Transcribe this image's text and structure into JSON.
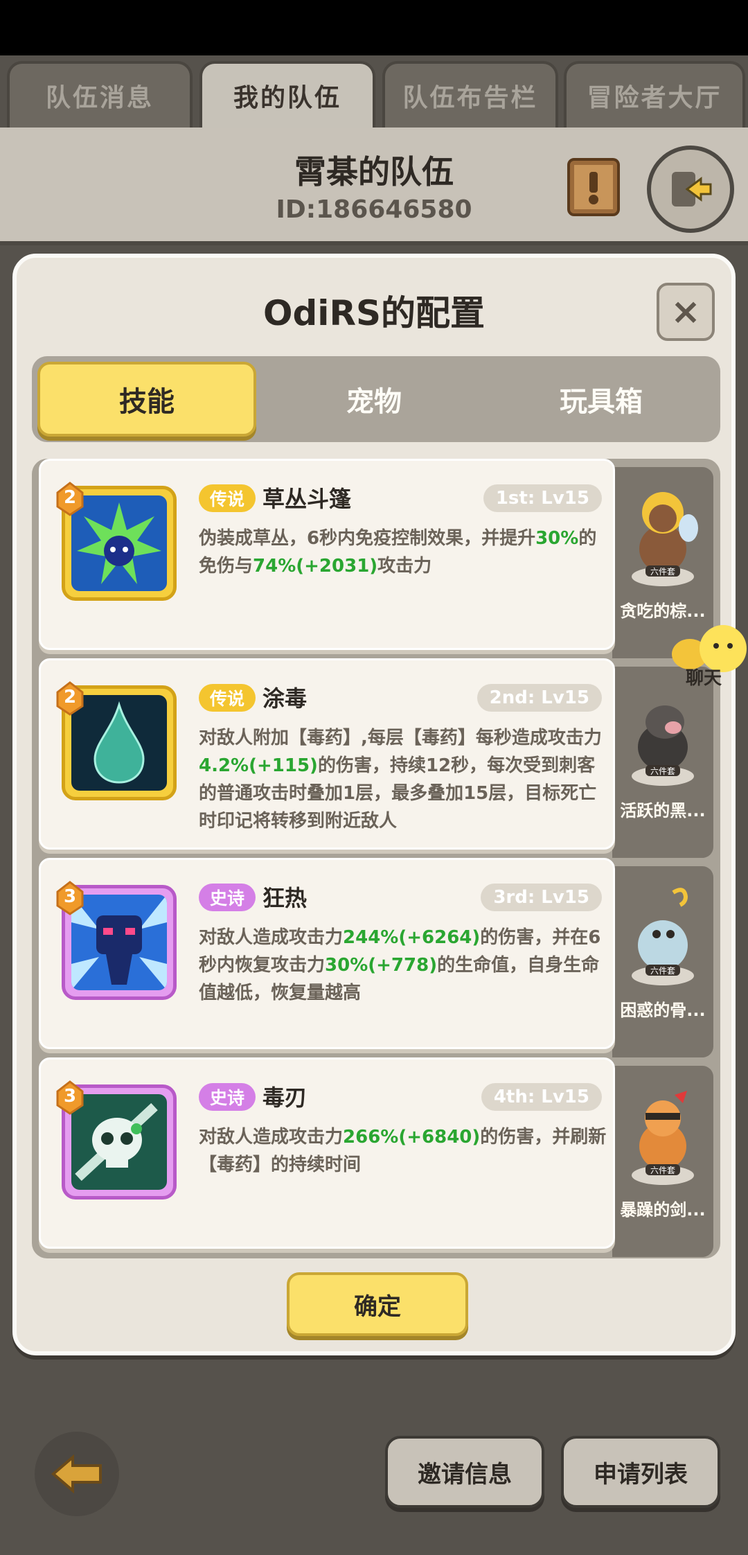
{
  "top_tabs": [
    "队伍消息",
    "我的队伍",
    "队伍布告栏",
    "冒险者大厅"
  ],
  "team": {
    "name": "霄棊的队伍",
    "id": "ID:186646580"
  },
  "modal": {
    "title": "OdiRS的配置",
    "close": "×",
    "tabs": [
      "技能",
      "宠物",
      "玩具箱"
    ],
    "confirm": "确定"
  },
  "skills": [
    {
      "level": "2",
      "rarity": "传说",
      "name": "草丛斗篷",
      "slot": "1st: Lv15",
      "desc": [
        "伪装成草丛，6秒内免疫控制效果，并提升",
        "30%",
        "的免伤与",
        "74%(+2031)",
        "攻击力"
      ]
    },
    {
      "level": "2",
      "rarity": "传说",
      "name": "涂毒",
      "slot": "2nd: Lv15",
      "desc": [
        "对敌人附加【毒药】,每层【毒药】每秒造成攻击力",
        "4.2%(+115)",
        "的伤害，持续12秒，每次受到刺客的普通攻击时叠加1层，最多叠加15层，目标死亡时印记将转移到附近敌人"
      ]
    },
    {
      "level": "3",
      "rarity": "史诗",
      "name": "狂热",
      "slot": "3rd: Lv15",
      "desc": [
        "对敌人造成攻击力",
        "244%(+6264)",
        "的伤害，并在6秒内恢复攻击力",
        "30%(+778)",
        "的生命值，自身生命值越低，恢复量越高"
      ]
    },
    {
      "level": "3",
      "rarity": "史诗",
      "name": "毒刃",
      "slot": "4th: Lv15",
      "desc": [
        "对敌人造成攻击力",
        "266%(+6840)",
        "的伤害，并刷新【毒药】的持续时间"
      ]
    }
  ],
  "pets": [
    {
      "name": "贪吃的棕...",
      "tag": "六件套"
    },
    {
      "name": "活跃的黑...",
      "tag": "六件套"
    },
    {
      "name": "困惑的骨...",
      "tag": "六件套"
    },
    {
      "name": "暴躁的剑...",
      "tag": "六件套"
    }
  ],
  "chat_label": "聊天",
  "bottom": {
    "invite": "邀请信息",
    "apply": "申请列表"
  },
  "colors": {
    "accent_yellow": "#fbe06a",
    "legend": "#f4c52f",
    "epic": "#d47fe6",
    "highlight_green": "#2aa631"
  }
}
